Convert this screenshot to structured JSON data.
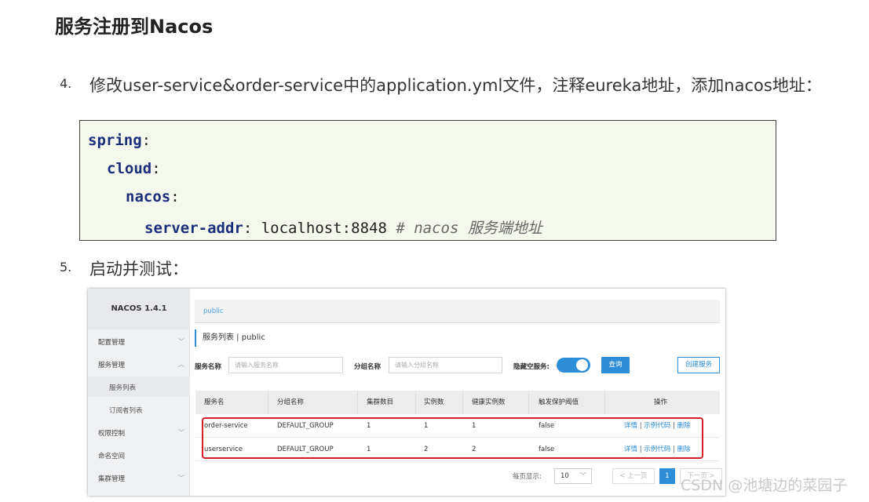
{
  "heading": "服务注册到Nacos",
  "steps": [
    {
      "num": "4.",
      "text": "修改user-service&order-service中的application.yml文件，注释eureka地址，添加nacos地址："
    },
    {
      "num": "5.",
      "text": "启动并测试："
    }
  ],
  "code": {
    "l1_key": "spring",
    "l2_key": "cloud",
    "l3_key": "nacos",
    "l4_key": "server-addr",
    "colon": ":",
    "l4_val": " localhost:8848 ",
    "l4_comment": "# nacos 服务端地址"
  },
  "nacos": {
    "brand": "NACOS 1.4.1",
    "sidebar": {
      "config": "配置管理",
      "service_mgmt": "服务管理",
      "service_list": "服务列表",
      "subscriber_list": "订阅者列表",
      "access": "权限控制",
      "namespace": "命名空间",
      "cluster": "集群管理"
    },
    "tab_namespace": "public",
    "title": "服务列表  |  public",
    "filters": {
      "service_name_label": "服务名称",
      "service_name_placeholder": "请输入服务名称",
      "group_name_label": "分组名称",
      "group_name_placeholder": "请输入分组名称",
      "hide_empty_label": "隐藏空服务:",
      "query": "查询",
      "create": "创建服务"
    },
    "table": {
      "headers": [
        "服务名",
        "分组名称",
        "集群数目",
        "实例数",
        "健康实例数",
        "触发保护阈值",
        "操作"
      ],
      "rows": [
        {
          "name": "order-service",
          "group": "DEFAULT_GROUP",
          "clusters": "1",
          "instances": "1",
          "healthy": "1",
          "threshold": "false"
        },
        {
          "name": "userservice",
          "group": "DEFAULT_GROUP",
          "clusters": "1",
          "instances": "2",
          "healthy": "2",
          "threshold": "false"
        }
      ],
      "ops": {
        "detail": "详情",
        "sample": "示例代码",
        "delete": "删除",
        "sep": "|"
      }
    },
    "pager": {
      "label": "每页显示:",
      "size": "10",
      "prev": "< 上一页",
      "page": "1",
      "next": "下一页 >"
    }
  },
  "watermark": "CSDN @池塘边的菜园子"
}
